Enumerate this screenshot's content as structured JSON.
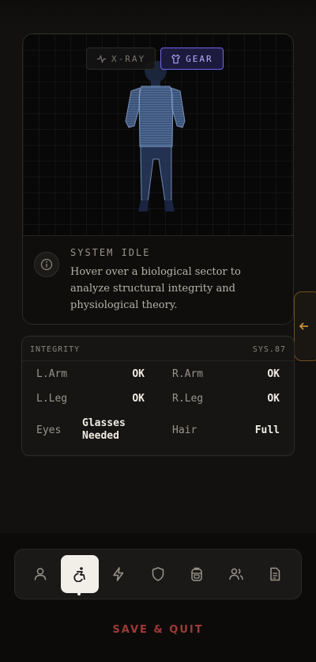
{
  "viewer": {
    "modes": [
      {
        "label": "X-RAY",
        "icon": "pulse-icon",
        "active": false
      },
      {
        "label": "GEAR",
        "icon": "shirt-icon",
        "active": true
      }
    ],
    "info": {
      "title": "SYSTEM IDLE",
      "text": "Hover over a biological sector to analyze structural integrity and physiological theory."
    }
  },
  "integrity": {
    "title": "INTEGRITY",
    "code": "SYS.87",
    "rows": [
      [
        {
          "label": "L.Arm",
          "value": "OK"
        },
        {
          "label": "R.Arm",
          "value": "OK"
        }
      ],
      [
        {
          "label": "L.Leg",
          "value": "OK"
        },
        {
          "label": "R.Leg",
          "value": "OK"
        }
      ],
      [
        {
          "label": "Eyes",
          "value": "Glasses Needed"
        },
        {
          "label": "Hair",
          "value": "Full"
        }
      ]
    ]
  },
  "nav": {
    "items": [
      {
        "name": "user-icon",
        "active": false
      },
      {
        "name": "accessibility-icon",
        "active": true
      },
      {
        "name": "lightning-icon",
        "active": false
      },
      {
        "name": "shield-icon",
        "active": false
      },
      {
        "name": "backpack-icon",
        "active": false
      },
      {
        "name": "users-icon",
        "active": false
      },
      {
        "name": "document-icon",
        "active": false
      }
    ]
  },
  "footer": {
    "save_quit": "SAVE & QUIT"
  },
  "colors": {
    "accent_purple": "#6f66e8",
    "accent_orange": "#d49a3a",
    "danger": "#9e3a36"
  }
}
